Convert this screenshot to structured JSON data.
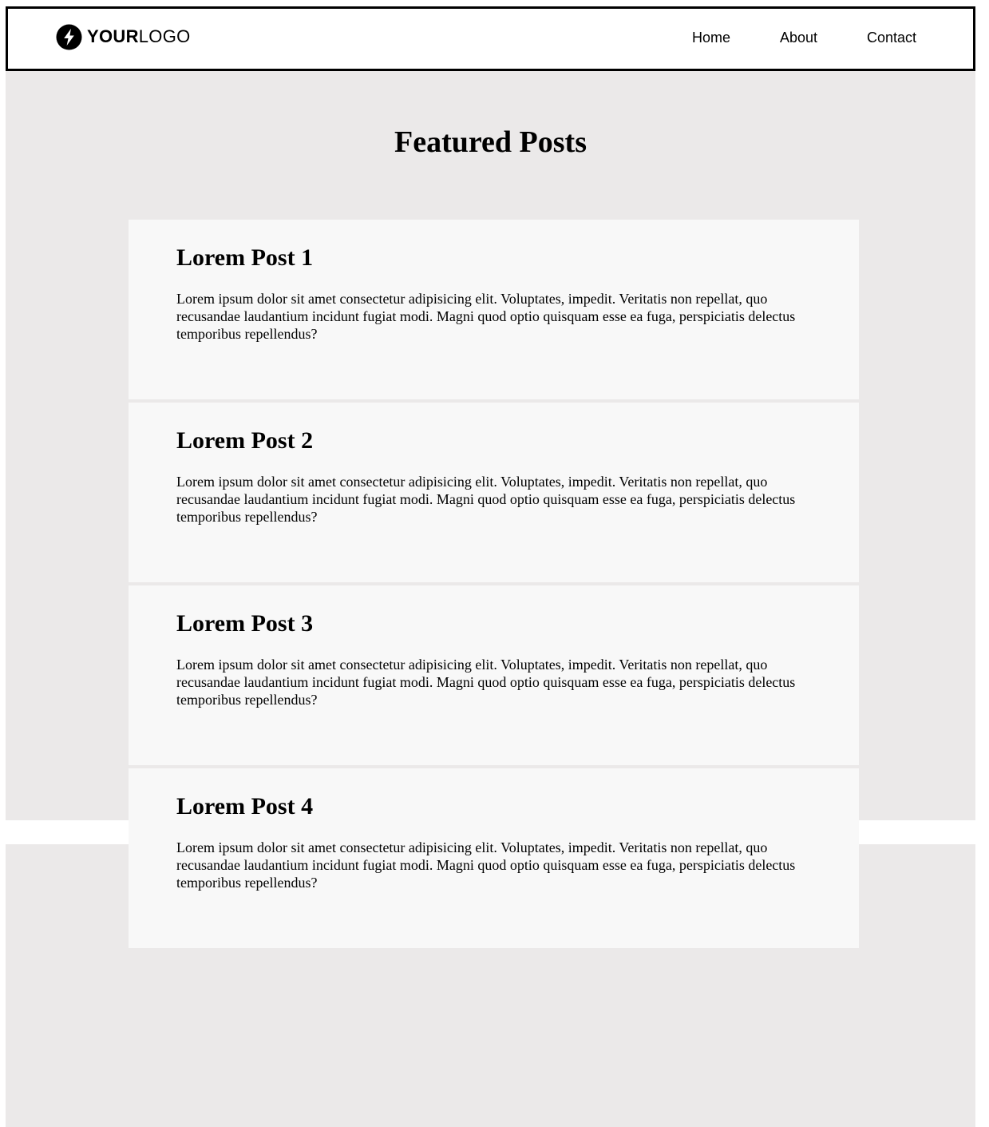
{
  "header": {
    "logo": {
      "bold": "YOUR",
      "light": "LOGO",
      "icon": "lightning-bolt-icon"
    },
    "nav": [
      {
        "label": "Home"
      },
      {
        "label": "About"
      },
      {
        "label": "Contact"
      }
    ]
  },
  "main": {
    "title": "Featured Posts",
    "posts": [
      {
        "title": "Lorem Post 1",
        "body": "Lorem ipsum dolor sit amet consectetur adipisicing elit. Voluptates, impedit. Veritatis non repellat, quo recusandae laudantium incidunt fugiat modi. Magni quod optio quisquam esse ea fuga, perspiciatis delectus temporibus repellendus?"
      },
      {
        "title": "Lorem Post 2",
        "body": "Lorem ipsum dolor sit amet consectetur adipisicing elit. Voluptates, impedit. Veritatis non repellat, quo recusandae laudantium incidunt fugiat modi. Magni quod optio quisquam esse ea fuga, perspiciatis delectus temporibus repellendus?"
      },
      {
        "title": "Lorem Post 3",
        "body": "Lorem ipsum dolor sit amet consectetur adipisicing elit. Voluptates, impedit. Veritatis non repellat, quo recusandae laudantium incidunt fugiat modi. Magni quod optio quisquam esse ea fuga, perspiciatis delectus temporibus repellendus?"
      },
      {
        "title": "Lorem Post 4",
        "body": "Lorem ipsum dolor sit amet consectetur adipisicing elit. Voluptates, impedit. Veritatis non repellat, quo recusandae laudantium incidunt fugiat modi. Magni quod optio quisquam esse ea fuga, perspiciatis delectus temporibus repellendus?"
      }
    ]
  },
  "colors": {
    "page_background": "#ebe9e9",
    "card_background": "#f8f8f8",
    "header_border": "#000000",
    "text": "#000000"
  }
}
